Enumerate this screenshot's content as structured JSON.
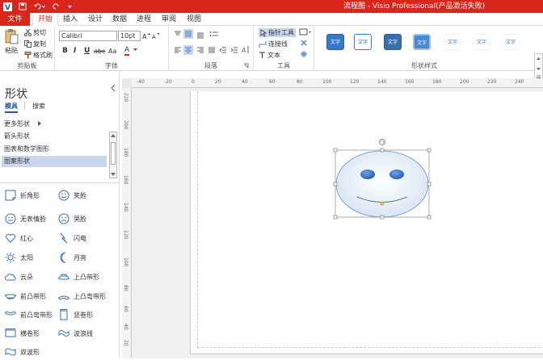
{
  "titlebar": {
    "title": "流程图 - Visio Professional(产品激活失败)",
    "qat": [
      "visio-logo-icon",
      "save-icon",
      "undo-icon",
      "redo-icon"
    ]
  },
  "tabs": [
    "文件",
    "开始",
    "插入",
    "设计",
    "数据",
    "进程",
    "审阅",
    "视图"
  ],
  "ribbon": {
    "clipboard": {
      "paste": "粘贴",
      "cut": "剪切",
      "copy": "复制",
      "format_painter": "格式刷",
      "label": "剪贴板"
    },
    "font": {
      "family": "Calibri",
      "size": "10pt",
      "bold": "B",
      "italic": "I",
      "underline": "U",
      "strike": "abc",
      "case": "Aa",
      "color": "A",
      "label": "字体"
    },
    "paragraph": {
      "label": "段落"
    },
    "tools": {
      "pointer": "指针工具",
      "connector": "连接线",
      "text": "文本",
      "label": "工具"
    },
    "shape_styles": {
      "label": "形状样式",
      "items": [
        "文字",
        "文字",
        "文字",
        "文字",
        "文字",
        "文字",
        "文字"
      ]
    }
  },
  "panel": {
    "title": "形状",
    "tab_stencils": "模具",
    "tab_search": "搜索",
    "more_shapes": "更多形状",
    "stencils": [
      "箭头形状",
      "图表和数学图形",
      "图案形状"
    ],
    "shapes": [
      {
        "label": "折角形",
        "icon": "folded-corner-icon"
      },
      {
        "label": "笑脸",
        "icon": "smiley-icon"
      },
      {
        "label": "无表情脸",
        "icon": "neutral-face-icon"
      },
      {
        "label": "哭脸",
        "icon": "sad-face-icon"
      },
      {
        "label": "红心",
        "icon": "heart-icon"
      },
      {
        "label": "闪电",
        "icon": "lightning-icon"
      },
      {
        "label": "太阳",
        "icon": "sun-icon"
      },
      {
        "label": "月亮",
        "icon": "moon-icon"
      },
      {
        "label": "云朵",
        "icon": "cloud-icon"
      },
      {
        "label": "上凸带形",
        "icon": "ribbon-up-icon"
      },
      {
        "label": "前凸带形",
        "icon": "ribbon-front-icon"
      },
      {
        "label": "上凸弯带形",
        "icon": "curved-ribbon-up-icon"
      },
      {
        "label": "前凸弯带形",
        "icon": "curved-ribbon-front-icon"
      },
      {
        "label": "竖卷形",
        "icon": "vertical-scroll-icon"
      },
      {
        "label": "横卷形",
        "icon": "horizontal-scroll-icon"
      },
      {
        "label": "波浪线",
        "icon": "wave-icon"
      },
      {
        "label": "双波形",
        "icon": "double-wave-icon"
      }
    ]
  },
  "ruler": {
    "h": [
      "-40",
      "-20",
      "0",
      "20",
      "40",
      "60",
      "80",
      "100",
      "120",
      "140",
      "160",
      "180",
      "200",
      "220",
      "240"
    ],
    "v": [
      "220",
      "200",
      "180",
      "160",
      "140",
      "120",
      "100",
      "80",
      "60",
      "40",
      "20"
    ]
  },
  "colors": {
    "accent": "#d9261c",
    "style_blue": "#3a78c9"
  }
}
